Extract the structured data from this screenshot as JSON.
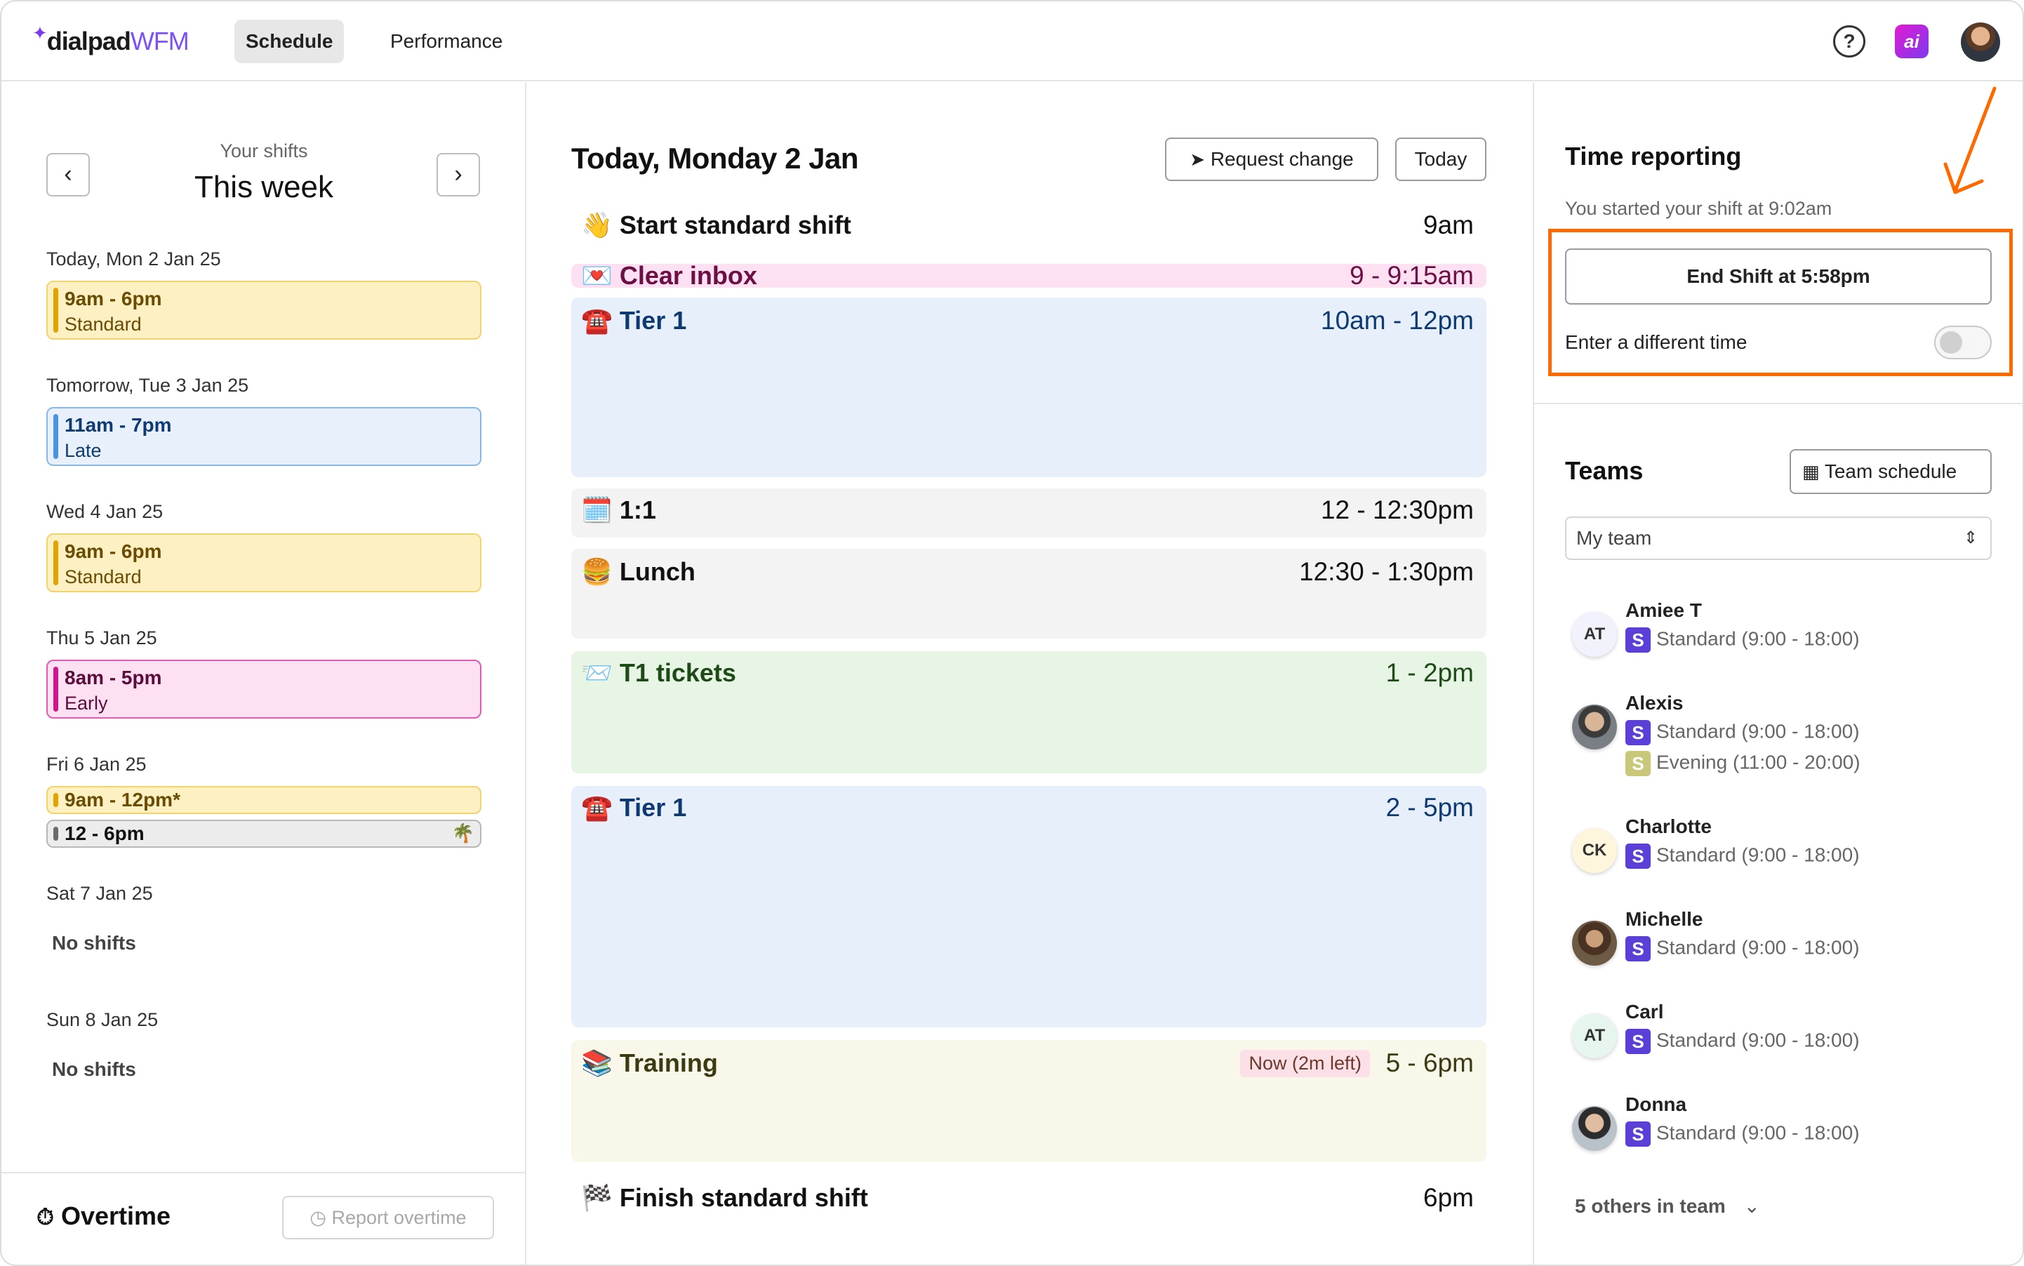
{
  "app": {
    "logo_brand": "dialpad",
    "logo_product": "WFM",
    "tabs": [
      {
        "label": "Schedule"
      },
      {
        "label": "Performance"
      }
    ],
    "icons": {
      "help": "?",
      "ai": "ai"
    }
  },
  "week": {
    "subtitle": "Your shifts",
    "title": "This week",
    "days": [
      {
        "label": "Today, Mon 2 Jan 25",
        "time": "9am - 6pm",
        "type": "Standard"
      },
      {
        "label": "Tomorrow, Tue 3 Jan 25",
        "time": "11am - 7pm",
        "type": "Late"
      },
      {
        "label": "Wed 4 Jan 25",
        "time": "9am - 6pm",
        "type": "Standard"
      },
      {
        "label": "Thu 5 Jan 25",
        "time": "8am - 5pm",
        "type": "Early"
      },
      {
        "label": "Fri 6 Jan 25",
        "time": "9am - 12pm*",
        "time2": "12 - 6pm"
      },
      {
        "label": "Sat 7 Jan 25",
        "empty": "No shifts"
      },
      {
        "label": "Sun 8 Jan 25",
        "empty": "No shifts"
      }
    ],
    "overtime_label": "Overtime",
    "report_overtime": "Report overtime"
  },
  "day": {
    "title": "Today, Monday 2 Jan",
    "request_change": "Request change",
    "today": "Today",
    "events": [
      {
        "emoji": "👋",
        "name": "Start standard shift",
        "time": "9am"
      },
      {
        "emoji": "💌",
        "name": "Clear inbox",
        "time": "9 - 9:15am"
      },
      {
        "emoji": "☎️",
        "name": "Tier 1",
        "time": "10am - 12pm"
      },
      {
        "emoji": "🗓️",
        "name": "1:1",
        "time": "12 - 12:30pm"
      },
      {
        "emoji": "🍔",
        "name": "Lunch",
        "time": "12:30 - 1:30pm"
      },
      {
        "emoji": "📨",
        "name": "T1 tickets",
        "time": "1 - 2pm"
      },
      {
        "emoji": "☎️",
        "name": "Tier 1",
        "time": "2 - 5pm"
      },
      {
        "emoji": "📚",
        "name": "Training",
        "time": "5 - 6pm",
        "badge": "Now (2m left)"
      },
      {
        "emoji": "🏁",
        "name": "Finish standard shift",
        "time": "6pm"
      }
    ]
  },
  "time_reporting": {
    "title": "Time reporting",
    "started": "You started your shift at 9:02am",
    "end_shift": "End Shift at 5:58pm",
    "different_time": "Enter a different time"
  },
  "teams": {
    "title": "Teams",
    "team_schedule": "Team schedule",
    "select_value": "My team",
    "members": [
      {
        "name": "Amiee T",
        "initials": "AT",
        "shifts": [
          {
            "badge": "S",
            "text": "Standard (9:00 - 18:00)"
          }
        ]
      },
      {
        "name": "Alexis",
        "initials": "",
        "shifts": [
          {
            "badge": "S",
            "text": "Standard (9:00 - 18:00)"
          },
          {
            "badge": "S",
            "text": "Evening (11:00 - 20:00)"
          }
        ]
      },
      {
        "name": "Charlotte",
        "initials": "CK",
        "shifts": [
          {
            "badge": "S",
            "text": "Standard (9:00 - 18:00)"
          }
        ]
      },
      {
        "name": "Michelle",
        "initials": "",
        "shifts": [
          {
            "badge": "S",
            "text": "Standard (9:00 - 18:00)"
          }
        ]
      },
      {
        "name": "Carl",
        "initials": "AT",
        "shifts": [
          {
            "badge": "S",
            "text": "Standard (9:00 - 18:00)"
          }
        ]
      },
      {
        "name": "Donna",
        "initials": "",
        "shifts": [
          {
            "badge": "S",
            "text": "Standard (9:00 - 18:00)"
          }
        ]
      }
    ],
    "others": "5 others in team"
  },
  "colors": {
    "accent": "#7c52f5",
    "highlight": "#ff6a00",
    "standard_badge": "#5b3fd6",
    "evening_badge": "#c8c77a"
  }
}
